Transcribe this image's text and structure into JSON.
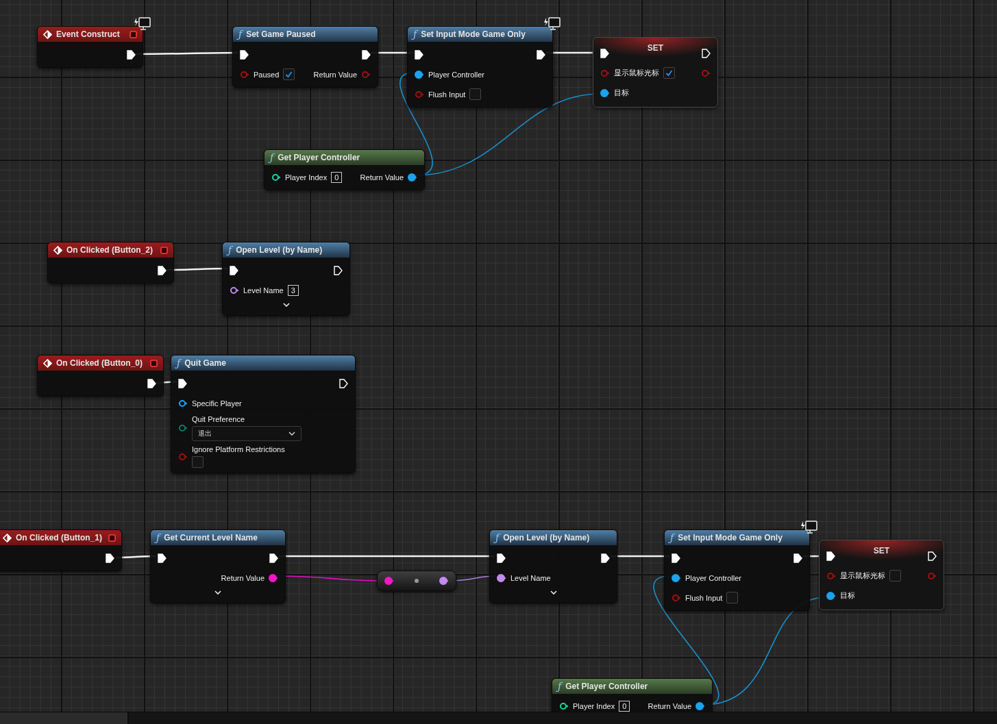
{
  "graph": {
    "nodes": [
      {
        "kind": "event",
        "title": "Event Construct",
        "network_icon": true,
        "outputs": [
          {
            "kind": "exec",
            "connected": true
          }
        ]
      },
      {
        "kind": "function",
        "glyph": "ƒ",
        "title": "Set Game Paused",
        "inputs": [
          {
            "kind": "exec",
            "connected": true
          },
          {
            "kind": "bool",
            "label": "Paused",
            "connected": false,
            "checked": true
          }
        ],
        "outputs": [
          {
            "kind": "exec",
            "connected": true
          },
          {
            "kind": "bool",
            "label": "Return Value",
            "connected": false
          }
        ]
      },
      {
        "kind": "function",
        "glyph": "ƒ",
        "title": "Set Input Mode Game Only",
        "network_icon": true,
        "inputs": [
          {
            "kind": "exec",
            "connected": true
          },
          {
            "kind": "object",
            "label": "Player Controller",
            "connected": true
          },
          {
            "kind": "bool",
            "label": "Flush Input",
            "connected": false,
            "checked": false
          }
        ],
        "outputs": [
          {
            "kind": "exec",
            "connected": true
          }
        ]
      },
      {
        "kind": "set",
        "title": "SET",
        "inputs": [
          {
            "kind": "exec",
            "connected": true
          },
          {
            "kind": "bool",
            "label": "显示鼠标光标",
            "connected": false,
            "checked": true
          },
          {
            "kind": "object",
            "label": "目标",
            "connected": true
          }
        ],
        "outputs": [
          {
            "kind": "exec",
            "connected": false
          },
          {
            "kind": "bool",
            "connected": false
          }
        ]
      },
      {
        "kind": "pure",
        "glyph": "ƒ",
        "title": "Get Player Controller",
        "inputs": [
          {
            "kind": "int",
            "label": "Player Index",
            "connected": false,
            "value": "0"
          }
        ],
        "outputs": [
          {
            "kind": "object",
            "label": "Return Value",
            "connected": true
          }
        ]
      },
      {
        "kind": "event",
        "title": "On Clicked (Button_2)",
        "outputs": [
          {
            "kind": "exec",
            "connected": true
          }
        ]
      },
      {
        "kind": "function",
        "glyph": "ƒ",
        "title": "Open Level (by Name)",
        "advanced": true,
        "inputs": [
          {
            "kind": "exec",
            "connected": true
          },
          {
            "kind": "name",
            "label": "Level Name",
            "connected": false,
            "value": "3"
          }
        ],
        "outputs": [
          {
            "kind": "exec",
            "connected": false
          }
        ]
      },
      {
        "kind": "event",
        "title": "On Clicked (Button_0)",
        "outputs": [
          {
            "kind": "exec",
            "connected": true
          }
        ]
      },
      {
        "kind": "function",
        "glyph": "ƒ",
        "title": "Quit Game",
        "inputs": [
          {
            "kind": "exec",
            "connected": true
          },
          {
            "kind": "object",
            "label": "Specific Player",
            "connected": false
          },
          {
            "kind": "enum",
            "label": "Quit Preference",
            "connected": false,
            "value": "退出",
            "stacked": true
          },
          {
            "kind": "bool",
            "label": "Ignore Platform Restrictions",
            "connected": false,
            "checked": false,
            "stacked": true
          }
        ],
        "outputs": [
          {
            "kind": "exec",
            "connected": false
          }
        ]
      },
      {
        "kind": "event",
        "title": "On Clicked (Button_1)",
        "outputs": [
          {
            "kind": "exec",
            "connected": true
          }
        ]
      },
      {
        "kind": "function",
        "glyph": "ƒ",
        "title": "Get Current Level Name",
        "advanced": true,
        "inputs": [
          {
            "kind": "exec",
            "connected": true
          }
        ],
        "outputs": [
          {
            "kind": "exec",
            "connected": true
          },
          {
            "kind": "string",
            "label": "Return Value",
            "connected": true
          }
        ]
      },
      {
        "kind": "conversion",
        "inputs": [
          {
            "kind": "string",
            "connected": true
          }
        ],
        "outputs": [
          {
            "kind": "name",
            "connected": true
          }
        ]
      },
      {
        "kind": "function",
        "glyph": "ƒ",
        "title": "Open Level (by Name)",
        "advanced": true,
        "inputs": [
          {
            "kind": "exec",
            "connected": true
          },
          {
            "kind": "name",
            "label": "Level Name",
            "connected": true
          }
        ],
        "outputs": [
          {
            "kind": "exec",
            "connected": true
          }
        ]
      },
      {
        "kind": "function",
        "glyph": "ƒ",
        "title": "Set Input Mode Game Only",
        "network_icon": true,
        "inputs": [
          {
            "kind": "exec",
            "connected": true
          },
          {
            "kind": "object",
            "label": "Player Controller",
            "connected": true
          },
          {
            "kind": "bool",
            "label": "Flush Input",
            "connected": false,
            "checked": false
          }
        ],
        "outputs": [
          {
            "kind": "exec",
            "connected": true
          }
        ]
      },
      {
        "kind": "set",
        "title": "SET",
        "inputs": [
          {
            "kind": "exec",
            "connected": true
          },
          {
            "kind": "bool",
            "label": "显示鼠标光标",
            "connected": false,
            "checked": false
          },
          {
            "kind": "object",
            "label": "目标",
            "connected": true
          }
        ],
        "outputs": [
          {
            "kind": "exec",
            "connected": false
          },
          {
            "kind": "bool",
            "connected": false
          }
        ]
      },
      {
        "kind": "pure",
        "glyph": "ƒ",
        "title": "Get Player Controller",
        "inputs": [
          {
            "kind": "int",
            "label": "Player Index",
            "connected": false,
            "value": "0"
          }
        ],
        "outputs": [
          {
            "kind": "object",
            "label": "Return Value",
            "connected": true
          }
        ]
      }
    ],
    "links": [
      {
        "kind": "exec"
      },
      {
        "kind": "exec"
      },
      {
        "kind": "exec"
      },
      {
        "kind": "object"
      },
      {
        "kind": "object"
      },
      {
        "kind": "exec"
      },
      {
        "kind": "exec"
      },
      {
        "kind": "exec"
      },
      {
        "kind": "exec"
      },
      {
        "kind": "string"
      },
      {
        "kind": "name"
      },
      {
        "kind": "exec"
      },
      {
        "kind": "exec"
      },
      {
        "kind": "object"
      },
      {
        "kind": "object"
      }
    ]
  }
}
